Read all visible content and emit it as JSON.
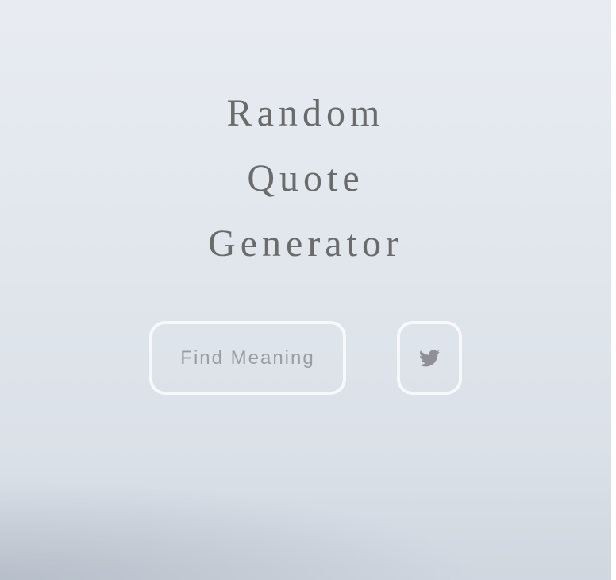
{
  "title": {
    "line1": "Random",
    "line2": "Quote",
    "line3": "Generator"
  },
  "buttons": {
    "find_label": "Find Meaning",
    "tweet_icon": "twitter-icon"
  },
  "colors": {
    "title_text": "#6b6b6b",
    "button_border": "#f7f8fa",
    "button_text": "#9a9ca3",
    "icon": "#8e9096",
    "background_top": "#e8ecf2",
    "background_bottom": "#d7dde5"
  }
}
